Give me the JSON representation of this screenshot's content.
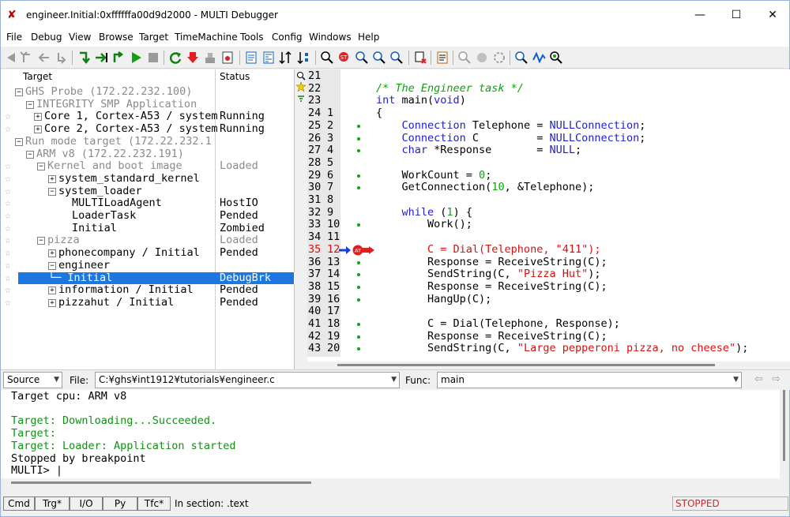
{
  "window": {
    "title": "engineer.Initial:0xffffffa00d9d2000 - MULTI Debugger",
    "minimize": "—",
    "maximize": "☐",
    "close": "✕"
  },
  "menu": [
    "File",
    "Debug",
    "View",
    "Browse",
    "Target",
    "TimeMachine",
    "Tools",
    "Config",
    "Windows",
    "Help"
  ],
  "target_tree": {
    "headers": {
      "target": "Target",
      "status": "Status"
    },
    "rows": [
      {
        "name": "GHS Probe (172.22.232.100)",
        "status": "",
        "star": false,
        "expander": "⊟",
        "grey": true,
        "selected": false
      },
      {
        "name": "INTEGRITY SMP Application",
        "status": "",
        "star": false,
        "expander": "⊟",
        "grey": true,
        "selected": false
      },
      {
        "name": "Core 1, Cortex-A53 / system",
        "status": "Running",
        "star": true,
        "expander": "⊞",
        "grey": false,
        "selected": false
      },
      {
        "name": "Core 2, Cortex-A53 / system",
        "status": "Running",
        "star": true,
        "expander": "⊞",
        "grey": false,
        "selected": false
      },
      {
        "name": "Run mode target (172.22.232.1",
        "status": "",
        "star": false,
        "expander": "⊟",
        "grey": true,
        "selected": false
      },
      {
        "name": "ARM v8 (172.22.232.191)",
        "status": "",
        "star": false,
        "expander": "⊟",
        "grey": true,
        "selected": false
      },
      {
        "name": "Kernel and boot image",
        "status": "Loaded",
        "star": true,
        "expander": "⊟",
        "grey": true,
        "selected": false
      },
      {
        "name": "system_standard_kernel",
        "status": "",
        "star": true,
        "expander": "⊞",
        "grey": false,
        "selected": false
      },
      {
        "name": "system_loader",
        "status": "",
        "star": true,
        "expander": "⊟",
        "grey": false,
        "selected": false
      },
      {
        "name": "MULTILoadAgent",
        "status": "HostIO",
        "star": true,
        "expander": "",
        "grey": false,
        "selected": false
      },
      {
        "name": "LoaderTask",
        "status": "Pended",
        "star": true,
        "expander": "",
        "grey": false,
        "selected": false
      },
      {
        "name": "Initial",
        "status": "Zombied",
        "star": true,
        "expander": "",
        "grey": false,
        "selected": false
      },
      {
        "name": "pizza",
        "status": "Loaded",
        "star": true,
        "expander": "⊟",
        "grey": true,
        "selected": false
      },
      {
        "name": "phonecompany / Initial",
        "status": "Pended",
        "star": true,
        "expander": "⊞",
        "grey": false,
        "selected": false
      },
      {
        "name": "engineer",
        "status": "",
        "star": true,
        "expander": "⊟",
        "grey": false,
        "selected": false
      },
      {
        "name": "Initial",
        "status": "DebugBrk",
        "star": true,
        "expander": "└─",
        "grey": false,
        "selected": true
      },
      {
        "name": "information / Initial",
        "status": "Pended",
        "star": true,
        "expander": "⊞",
        "grey": false,
        "selected": false
      },
      {
        "name": "pizzahut / Initial",
        "status": "Pended",
        "star": true,
        "expander": "⊞",
        "grey": false,
        "selected": false
      }
    ]
  },
  "source": {
    "lines": [
      {
        "ln1": "21",
        "ln2": "",
        "exec": false,
        "current": false,
        "text": ""
      },
      {
        "ln1": "22",
        "ln2": "",
        "exec": false,
        "current": false,
        "text": "/* The Engineer task */"
      },
      {
        "ln1": "23",
        "ln2": "",
        "exec": false,
        "current": false,
        "text": "int main(void)"
      },
      {
        "ln1": "24",
        "ln2": "1",
        "exec": false,
        "current": false,
        "text": "{"
      },
      {
        "ln1": "25",
        "ln2": "2",
        "exec": true,
        "current": false,
        "text": "    Connection Telephone = NULLConnection;"
      },
      {
        "ln1": "26",
        "ln2": "3",
        "exec": true,
        "current": false,
        "text": "    Connection C         = NULLConnection;"
      },
      {
        "ln1": "27",
        "ln2": "4",
        "exec": true,
        "current": false,
        "text": "    char *Response       = NULL;"
      },
      {
        "ln1": "28",
        "ln2": "5",
        "exec": false,
        "current": false,
        "text": ""
      },
      {
        "ln1": "29",
        "ln2": "6",
        "exec": true,
        "current": false,
        "text": "    WorkCount = 0;"
      },
      {
        "ln1": "30",
        "ln2": "7",
        "exec": true,
        "current": false,
        "text": "    GetConnection(10, &Telephone);"
      },
      {
        "ln1": "31",
        "ln2": "8",
        "exec": false,
        "current": false,
        "text": ""
      },
      {
        "ln1": "32",
        "ln2": "9",
        "exec": false,
        "current": false,
        "text": "    while (1) {"
      },
      {
        "ln1": "33",
        "ln2": "10",
        "exec": true,
        "current": false,
        "text": "        Work();"
      },
      {
        "ln1": "34",
        "ln2": "11",
        "exec": false,
        "current": false,
        "text": ""
      },
      {
        "ln1": "35",
        "ln2": "12",
        "exec": false,
        "current": true,
        "text": "        C = Dial(Telephone, \"411\");"
      },
      {
        "ln1": "36",
        "ln2": "13",
        "exec": true,
        "current": false,
        "text": "        Response = ReceiveString(C);"
      },
      {
        "ln1": "37",
        "ln2": "14",
        "exec": true,
        "current": false,
        "text": "        SendString(C, \"Pizza Hut\");"
      },
      {
        "ln1": "38",
        "ln2": "15",
        "exec": true,
        "current": false,
        "text": "        Response = ReceiveString(C);"
      },
      {
        "ln1": "39",
        "ln2": "16",
        "exec": true,
        "current": false,
        "text": "        HangUp(C);"
      },
      {
        "ln1": "40",
        "ln2": "17",
        "exec": false,
        "current": false,
        "text": ""
      },
      {
        "ln1": "41",
        "ln2": "18",
        "exec": true,
        "current": false,
        "text": "        C = Dial(Telephone, Response);"
      },
      {
        "ln1": "42",
        "ln2": "19",
        "exec": true,
        "current": false,
        "text": "        Response = ReceiveString(C);"
      },
      {
        "ln1": "43",
        "ln2": "20",
        "exec": true,
        "current": false,
        "text": "        SendString(C, \"Large pepperoni pizza, no cheese\");"
      }
    ],
    "breakpoint_label": "AT"
  },
  "file_bar": {
    "mode": "Source",
    "file_label": "File:",
    "file_path": "C:¥ghs¥int1912¥tutorials¥engineer.c",
    "func_label": "Func:",
    "func_value": "main"
  },
  "console": {
    "lines": [
      {
        "text": "Target cpu: ARM v8",
        "green": false
      },
      {
        "text": "",
        "green": false
      },
      {
        "text": "Target: Downloading...Succeeded.",
        "green": true
      },
      {
        "text": "Target:",
        "green": true
      },
      {
        "text": "Target: Loader: Application started",
        "green": true
      },
      {
        "text": "Stopped by breakpoint",
        "green": false
      },
      {
        "text": "MULTI> |",
        "green": false
      }
    ]
  },
  "status_bar": {
    "tabs": [
      "Cmd",
      "Trg*",
      "I/O",
      "Py",
      "Tfc*"
    ],
    "section": "In section: .text",
    "state": "STOPPED"
  },
  "colors": {
    "selection": "#1c78e0",
    "keyword": "#2020d0",
    "comment": "#10a010",
    "current_line": "#d81010",
    "stopped": "#e02020"
  }
}
